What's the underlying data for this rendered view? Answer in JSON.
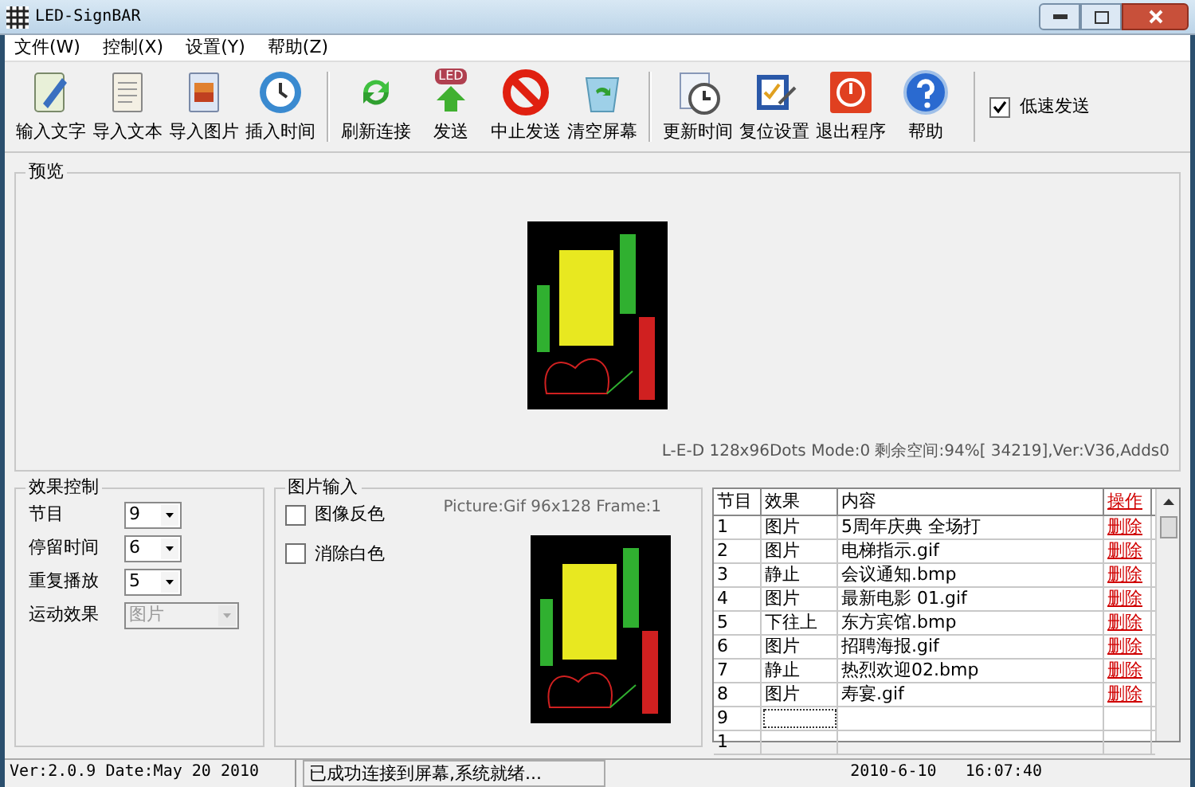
{
  "window": {
    "title": "LED-SignBAR"
  },
  "menu": [
    "文件(W)",
    "控制(X)",
    "设置(Y)",
    "帮助(Z)"
  ],
  "toolbar": [
    [
      {
        "kind": "notepad",
        "label": "输入文字"
      },
      {
        "kind": "document",
        "label": "导入文本"
      },
      {
        "kind": "picture",
        "label": "导入图片"
      },
      {
        "kind": "clock",
        "label": "插入时间"
      }
    ],
    [
      {
        "kind": "refresh",
        "label": "刷新连接"
      },
      {
        "kind": "send",
        "label": "发送",
        "badge": "LED"
      },
      {
        "kind": "stop",
        "label": "中止发送"
      },
      {
        "kind": "recycle",
        "label": "清空屏幕"
      }
    ],
    [
      {
        "kind": "clockdoc",
        "label": "更新时间"
      },
      {
        "kind": "checklist",
        "label": "复位设置"
      },
      {
        "kind": "power",
        "label": "退出程序"
      },
      {
        "kind": "help",
        "label": "帮助"
      }
    ]
  ],
  "low_speed": {
    "label": "低速发送",
    "checked": true
  },
  "preview": {
    "title": "预览",
    "info": "L-E-D 128x96Dots Mode:0 剩余空间:94%[ 34219],Ver:V36,Adds0"
  },
  "effect_control": {
    "title": "效果控制",
    "fields": [
      {
        "label": "节目",
        "value": "9",
        "disabled": false
      },
      {
        "label": "停留时间",
        "value": "6",
        "disabled": false
      },
      {
        "label": "重复播放",
        "value": "5",
        "disabled": false
      },
      {
        "label": "运动效果",
        "value": "图片",
        "disabled": true
      }
    ]
  },
  "picture_input": {
    "title": "图片输入",
    "info": "Picture:Gif 96x128 Frame:1",
    "options": [
      {
        "label": "图像反色",
        "checked": false
      },
      {
        "label": "消除白色",
        "checked": false
      }
    ]
  },
  "table": {
    "columns": [
      "节目",
      "效果",
      "内容",
      "操作"
    ],
    "rows": [
      {
        "cells": [
          "1",
          "图片",
          "5周年庆典 全场打",
          "删除"
        ]
      },
      {
        "cells": [
          "2",
          "图片",
          "电梯指示.gif",
          "删除"
        ]
      },
      {
        "cells": [
          "3",
          "静止",
          "会议通知.bmp",
          "删除"
        ]
      },
      {
        "cells": [
          "4",
          "图片",
          "最新电影 01.gif",
          "删除"
        ]
      },
      {
        "cells": [
          "5",
          "下往上",
          "东方宾馆.bmp",
          "删除"
        ]
      },
      {
        "cells": [
          "6",
          "图片",
          "招聘海报.gif",
          "删除"
        ]
      },
      {
        "cells": [
          "7",
          "静止",
          "热烈欢迎02.bmp",
          "删除"
        ]
      },
      {
        "cells": [
          "8",
          "图片",
          "寿宴.gif",
          "删除"
        ]
      },
      {
        "cells": [
          "9",
          "",
          "",
          ""
        ],
        "focused": true
      },
      {
        "cells": [
          "1",
          "",
          "",
          ""
        ]
      }
    ]
  },
  "status_bar": {
    "version": "Ver:2.0.9  Date:May 20 2010",
    "message": "已成功连接到屏幕,系统就绪...",
    "time": "2010-6-10   16:07:40"
  }
}
